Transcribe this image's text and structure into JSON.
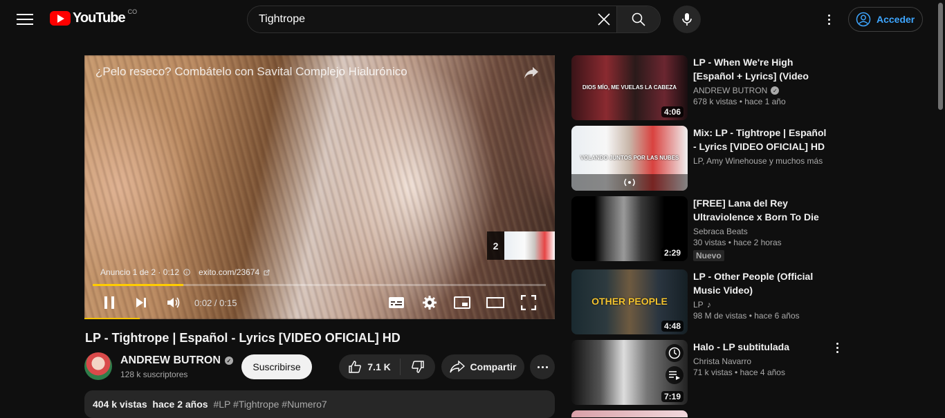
{
  "header": {
    "logo_text": "YouTube",
    "country_code": "CO",
    "search_value": "Tightrope",
    "signin_label": "Acceder"
  },
  "player": {
    "ad_title": "¿Pelo reseco? Combátelo con Savital Complejo Hialurónico",
    "next_count": "2",
    "ad_label": "Anuncio 1 de 2 · 0:12",
    "ad_url": "exito.com/23674",
    "time": "0:02 / 0:15",
    "progress_fraction": 0.2
  },
  "video": {
    "title": "LP - Tightrope | Español - Lyrics [VIDEO OFICIAL] HD",
    "channel": "ANDREW BUTRON",
    "subscribers": "128 k suscriptores",
    "subscribe_label": "Suscribirse",
    "likes": "7.1 K",
    "share_label": "Compartir",
    "views": "404 k vistas",
    "age": "hace 2 años",
    "tags": "#LP #Tightrope #Numero7"
  },
  "recommendations": [
    {
      "title": "LP - When We're High [Español + Lyrics] (Video Oficial)",
      "channel": "ANDREW BUTRON",
      "verified": true,
      "views": "678 k vistas",
      "age": "hace 1 año",
      "duration": "4:06",
      "thumb_caption": "DIOS MÍO, ME VUELAS LA CABEZA"
    },
    {
      "title": "Mix: LP - Tightrope | Español - Lyrics [VIDEO OFICIAL] HD",
      "channel": "LP, Amy Winehouse y muchos más",
      "thumb_caption": "VOLANDO JUNTOS POR LAS NUBES"
    },
    {
      "title": "[FREE] Lana del Rey Ultraviolence x Born To Die Ty…",
      "channel": "Sebraca Beats",
      "views": "30 vistas",
      "age": "hace 2 horas",
      "duration": "2:29",
      "badge": "Nuevo"
    },
    {
      "title": "LP - Other People (Official Music Video)",
      "channel": "LP",
      "views": "98 M de vistas",
      "age": "hace 6 años",
      "duration": "4:48",
      "thumb_caption": "OTHER PEOPLE"
    },
    {
      "title": "Halo - LP subtitulada",
      "channel": "Christa Navarro",
      "views": "71 k vistas",
      "age": "hace 4 años",
      "duration": "7:19"
    }
  ]
}
